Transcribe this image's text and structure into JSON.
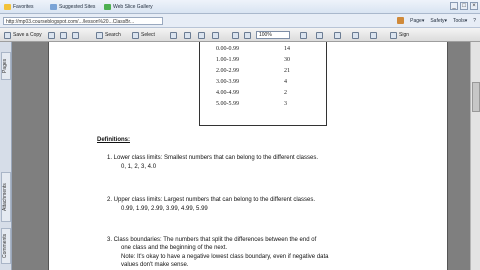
{
  "browser": {
    "favorites_label": "Favorites",
    "suggested_sites_label": "Suggested Sites",
    "web_slice_label": "Web Slice Gallery",
    "url": "http://mp03.courseblogspot.com/.../lesson%20...ClassBr...",
    "right_tools": [
      "Page▾",
      "Safety▾",
      "Tools▾",
      "?"
    ]
  },
  "toolbar": {
    "save_copy_label": "Save a Copy",
    "search_label": "Search",
    "select_label": "Select",
    "zoom_value": "100%",
    "sign_label": "Sign"
  },
  "sidepanel": {
    "pages_tab": "Pages",
    "attachments_tab": "Attachments",
    "comments_tab": "Comments"
  },
  "freq_table": {
    "rows": [
      {
        "range": "0.00-0.99",
        "count": "14"
      },
      {
        "range": "1.00-1.99",
        "count": "30"
      },
      {
        "range": "2.00-2.99",
        "count": "21"
      },
      {
        "range": "3.00-3.99",
        "count": "4"
      },
      {
        "range": "4.00-4.99",
        "count": "2"
      },
      {
        "range": "5.00-5.99",
        "count": "3"
      }
    ]
  },
  "definitions": {
    "heading": "Definitions:",
    "item1_title": "1.   Lower class limits:  Smallest numbers that can belong to the different classes.",
    "item1_values": "0, 1, 2, 3, 4.0",
    "item2_title": "2.   Upper class limits:  Largest numbers that can belong to the different classes.",
    "item2_values": "0.99, 1.99, 2.99, 3.99, 4.99, 5.99",
    "item3_title": "3.   Class boundaries:  The numbers that split the differences between the end of",
    "item3_line2": "one class and the beginning of the next.",
    "item3_line3": "Note: It's okay to have a negative lowest class boundary, even if negative data",
    "item3_line4": "values don't make sense."
  }
}
